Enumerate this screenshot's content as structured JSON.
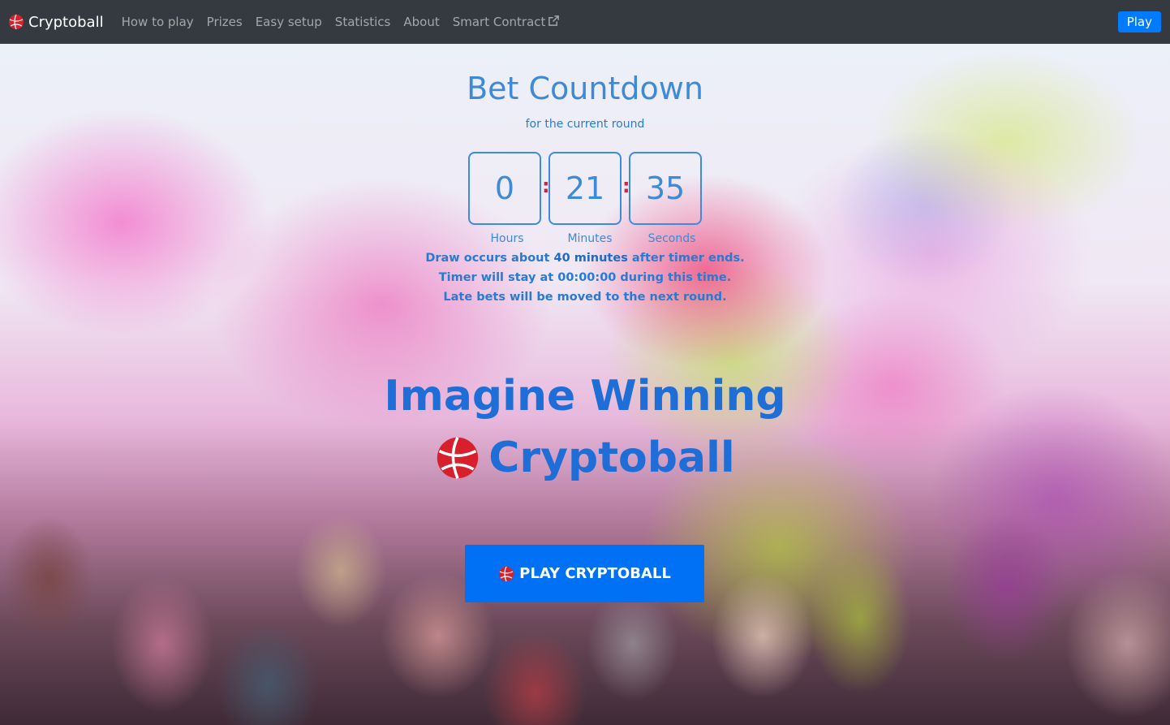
{
  "navbar": {
    "brand": "Cryptoball",
    "links": [
      "How to play",
      "Prizes",
      "Easy setup",
      "Statistics",
      "About",
      "Smart Contract"
    ],
    "play_button": "Play",
    "external_link_icon": "external-link-icon"
  },
  "countdown": {
    "title": "Bet Countdown",
    "subtitle": "for the current round",
    "hours": "0",
    "minutes": "21",
    "seconds": "35",
    "separator": ":",
    "labels": {
      "hours": "Hours",
      "minutes": "Minutes",
      "seconds": "Seconds"
    }
  },
  "notes": {
    "line1_prefix": "Draw occurs about",
    "line1_bold": "40 minutes",
    "line1_suffix": "after timer ends.",
    "line2": "Timer will stay at 00:00:00 during this time.",
    "line3": "Late bets will be moved to the next round."
  },
  "hero": {
    "headline": "Imagine Winning",
    "brand": "Cryptoball",
    "cta_label": "PLAY CRYPTOBALL"
  },
  "colors": {
    "navbar_bg": "#343a40",
    "primary": "#007bff",
    "ball_red": "#d8202c",
    "title_blue": "#3d8ad6"
  }
}
